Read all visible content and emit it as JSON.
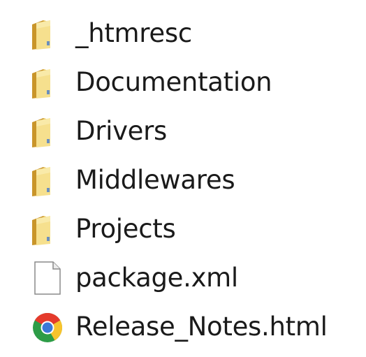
{
  "items": [
    {
      "name": "_htmresc",
      "type": "folder",
      "icon": "folder-icon"
    },
    {
      "name": "Documentation",
      "type": "folder",
      "icon": "folder-icon"
    },
    {
      "name": "Drivers",
      "type": "folder",
      "icon": "folder-icon"
    },
    {
      "name": "Middlewares",
      "type": "folder",
      "icon": "folder-icon"
    },
    {
      "name": "Projects",
      "type": "folder",
      "icon": "folder-icon"
    },
    {
      "name": "package.xml",
      "type": "file",
      "icon": "file-icon"
    },
    {
      "name": "Release_Notes.html",
      "type": "html",
      "icon": "chrome-icon"
    }
  ],
  "colors": {
    "folder_back": "#d9a82e",
    "folder_front": "#f2d77a",
    "text": "#1a1a1a"
  }
}
